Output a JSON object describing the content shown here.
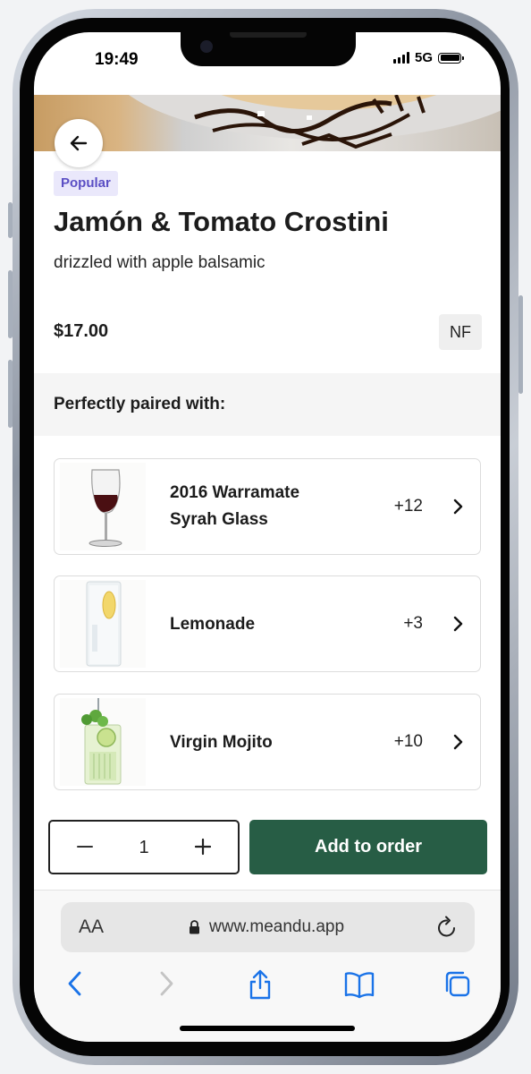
{
  "status_bar": {
    "time": "19:49",
    "network": "5G"
  },
  "product": {
    "badge": "Popular",
    "name": "Jamón & Tomato Crostini",
    "description": "drizzled with apple balsamic",
    "price": "$17.00",
    "diet_tag": "NF"
  },
  "pairings": {
    "title": "Perfectly paired with:",
    "items": [
      {
        "name": "2016 Warramate Syrah Glass",
        "extra": "+12",
        "icon": "wine-glass"
      },
      {
        "name": "Lemonade",
        "extra": "+3",
        "icon": "lemonade-glass"
      },
      {
        "name": "Virgin Mojito",
        "extra": "+10",
        "icon": "mojito-glass"
      }
    ]
  },
  "order": {
    "quantity": "1",
    "add_label": "Add to order"
  },
  "browser": {
    "text_size_label": "AA",
    "url": "www.meandu.app"
  },
  "colors": {
    "primary": "#275d45",
    "badge_bg": "#eae8fb",
    "badge_text": "#5b4fc4"
  }
}
